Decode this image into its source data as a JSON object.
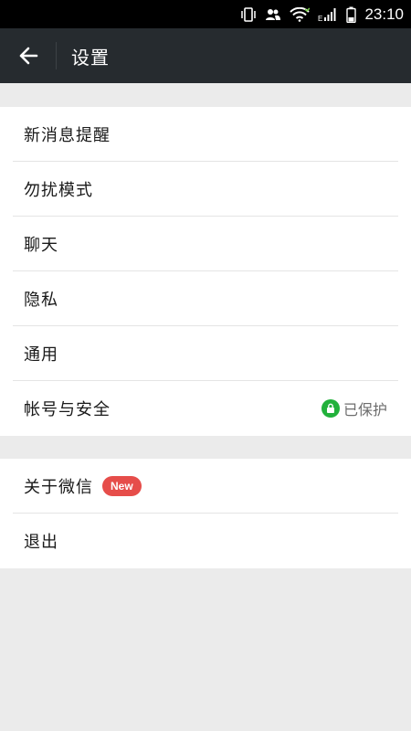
{
  "status_bar": {
    "time": "23:10",
    "icons": [
      "vibrate-icon",
      "contacts-icon",
      "wifi-icon",
      "signal-icon",
      "battery-icon"
    ]
  },
  "header": {
    "back_icon": "arrow-left-icon",
    "title": "设置"
  },
  "colors": {
    "header_bg": "#262b2f",
    "new_badge": "#e64d4a",
    "secure_green": "#22b13b",
    "page_bg": "#ebebeb"
  },
  "groups": [
    {
      "items": [
        {
          "label": "新消息提醒"
        },
        {
          "label": "勿扰模式"
        },
        {
          "label": "聊天"
        },
        {
          "label": "隐私"
        },
        {
          "label": "通用"
        },
        {
          "label": "帐号与安全",
          "status": "已保护",
          "status_icon": "lock-icon"
        }
      ]
    },
    {
      "items": [
        {
          "label": "关于微信",
          "badge": "New"
        },
        {
          "label": "退出"
        }
      ]
    }
  ]
}
